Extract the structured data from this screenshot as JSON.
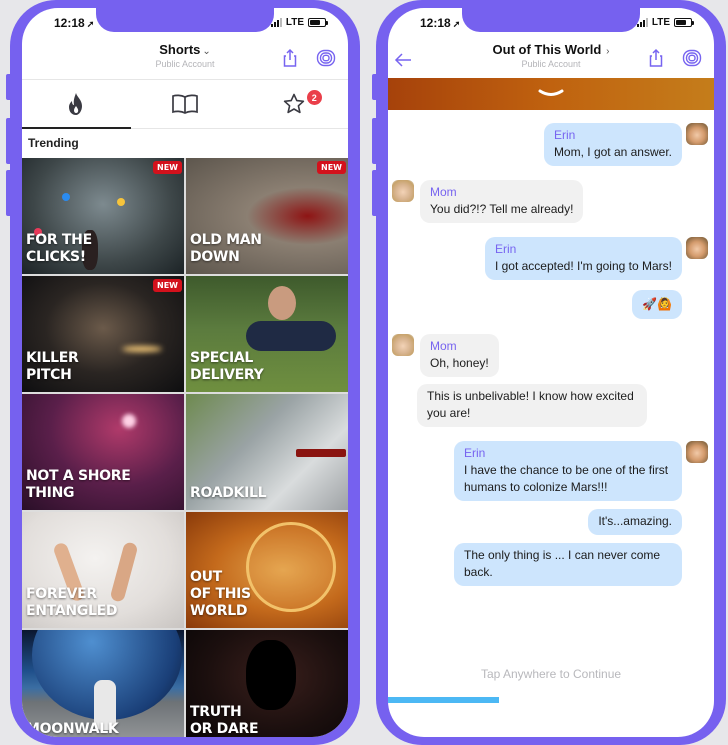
{
  "left_phone": {
    "status": {
      "time": "12:18",
      "carrier": "LTE"
    },
    "header": {
      "title": "Shorts",
      "subtitle": "Public Account"
    },
    "tabs": [
      {
        "icon": "flame-icon",
        "active": true
      },
      {
        "icon": "book-icon",
        "active": false
      },
      {
        "icon": "star-icon",
        "active": false,
        "badge": "2"
      }
    ],
    "section_title": "Trending",
    "stories": [
      {
        "title": "For the\nclicks!",
        "new_badge": "NEW"
      },
      {
        "title": "Old man\ndown",
        "new_badge": "NEW"
      },
      {
        "title": "Killer\npitch",
        "new_badge": "NEW"
      },
      {
        "title": "Special\ndelivery",
        "new_badge": ""
      },
      {
        "title": "Not a shore\nthing",
        "new_badge": ""
      },
      {
        "title": "Roadkill",
        "new_badge": ""
      },
      {
        "title": "Forever\nentangled",
        "new_badge": ""
      },
      {
        "title": "Out\nof this\nworld",
        "new_badge": ""
      },
      {
        "title": "Moonwalk",
        "new_badge": ""
      },
      {
        "title": "Truth\nor dare",
        "new_badge": ""
      }
    ]
  },
  "right_phone": {
    "status": {
      "time": "12:18",
      "carrier": "LTE"
    },
    "header": {
      "title": "Out of This World",
      "subtitle": "Public Account"
    },
    "messages": [
      {
        "sender": "Erin",
        "text": "Mom, I got an answer.",
        "side": "out"
      },
      {
        "sender": "Mom",
        "text": "You did?!? Tell me already!",
        "side": "in"
      },
      {
        "sender": "Erin",
        "text": "I got accepted! I'm going to Mars!",
        "side": "out"
      },
      {
        "sender": "",
        "text": "🚀🙆",
        "side": "out"
      },
      {
        "sender": "Mom",
        "text": "Oh, honey!",
        "side": "in"
      },
      {
        "sender": "",
        "text": "This is unbelivable! I know how excited you are!",
        "side": "in"
      },
      {
        "sender": "Erin",
        "text": "I have the chance to be one of the first humans to colonize Mars!!!",
        "side": "out"
      },
      {
        "sender": "",
        "text": "It's...amazing.",
        "side": "out"
      },
      {
        "sender": "",
        "text": "The only thing is ... I can never come back.",
        "side": "out"
      }
    ],
    "tap_hint": "Tap Anywhere to Continue",
    "progress_percent": 34
  },
  "colors": {
    "frame": "#7661ef",
    "accent": "#7764f0",
    "outgoing_bubble": "#cde5fd",
    "incoming_bubble": "#f1f1f1",
    "badge": "#ea3f4a",
    "new_badge": "#d3111c",
    "progress": "#4cb8f4"
  }
}
